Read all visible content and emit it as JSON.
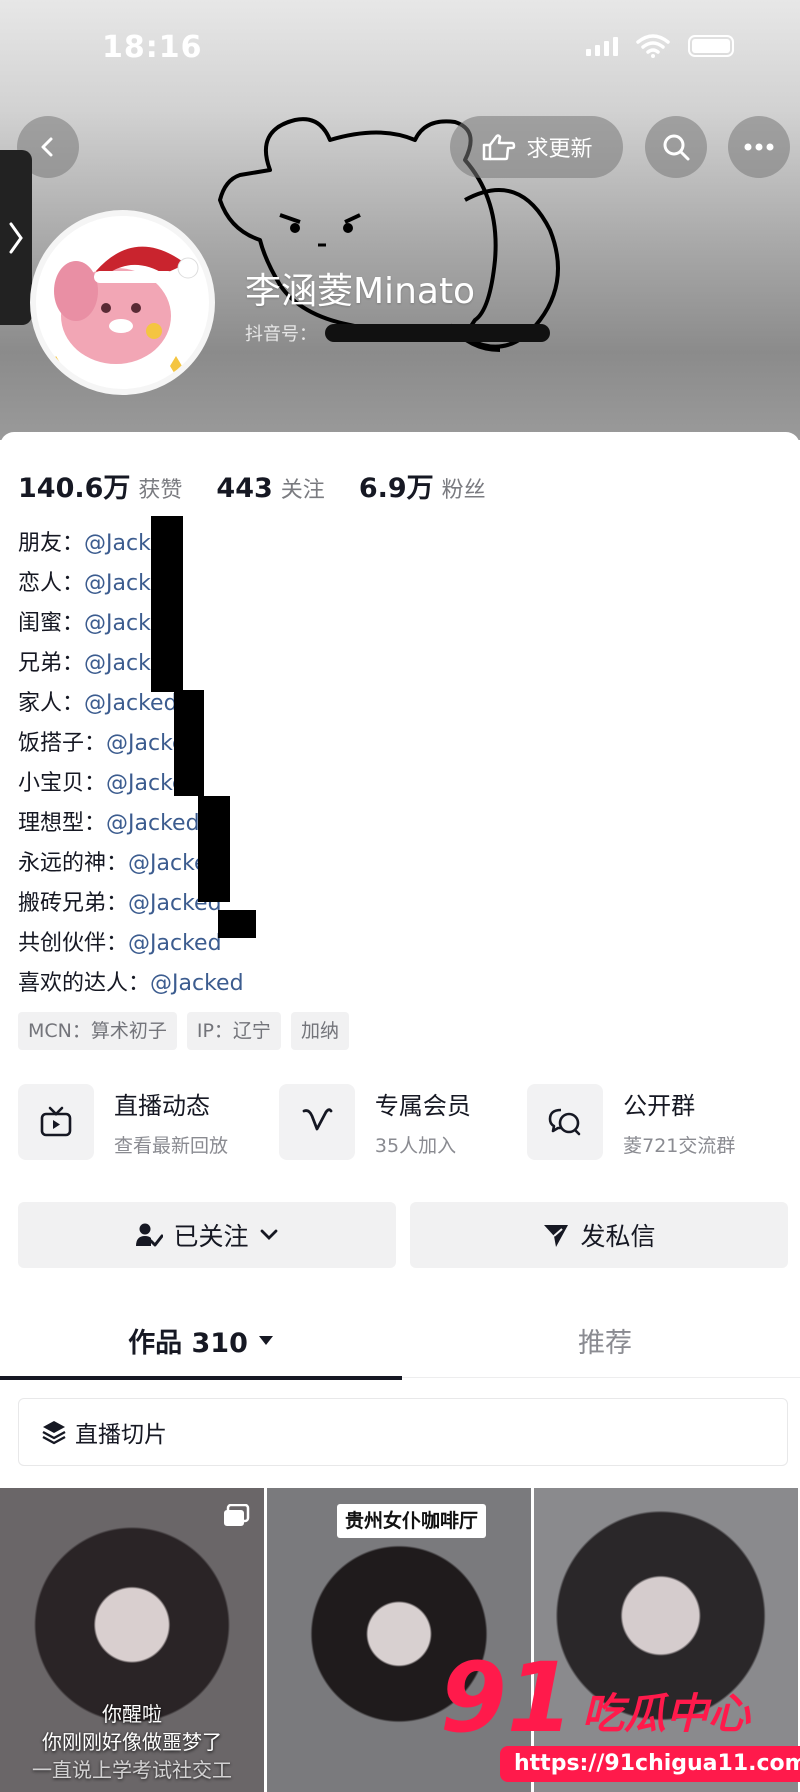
{
  "status_bar": {
    "time": "18:16"
  },
  "header": {
    "update_label": "求更新",
    "nickname": "李涵菱Minato",
    "douyin_id_label": "抖音号："
  },
  "stats": [
    {
      "value": "140.6万",
      "label": "获赞"
    },
    {
      "value": "443",
      "label": "关注"
    },
    {
      "value": "6.9万",
      "label": "粉丝"
    }
  ],
  "bio": [
    {
      "label": "朋友：",
      "mention": "@Jacked"
    },
    {
      "label": "恋人：",
      "mention": "@Jacked"
    },
    {
      "label": "闺蜜：",
      "mention": "@Jacked"
    },
    {
      "label": "兄弟：",
      "mention": "@Jacked"
    },
    {
      "label": "家人：",
      "mention": "@Jacked"
    },
    {
      "label": "饭搭子：",
      "mention": "@Jacked"
    },
    {
      "label": "小宝贝：",
      "mention": "@Jacked"
    },
    {
      "label": "理想型：",
      "mention": "@Jacked"
    },
    {
      "label": "永远的神：",
      "mention": "@Jacked"
    },
    {
      "label": "搬砖兄弟：",
      "mention": "@Jacked"
    },
    {
      "label": "共创伙伴：",
      "mention": "@Jacked"
    },
    {
      "label": "喜欢的达人：",
      "mention": "@Jacked"
    }
  ],
  "tags": [
    "MCN：算术初子",
    "IP：辽宁",
    "加纳"
  ],
  "features": [
    {
      "icon": "tv-icon",
      "title": "直播动态",
      "subtitle": "查看最新回放"
    },
    {
      "icon": "v-badge-icon",
      "title": "专属会员",
      "subtitle": "35人加入"
    },
    {
      "icon": "chat-bubbles-icon",
      "title": "公开群",
      "subtitle": "菱721交流群"
    }
  ],
  "actions": {
    "follow_label": "已关注",
    "message_label": "发私信"
  },
  "tabs": {
    "works_label": "作品 310",
    "recommend_label": "推荐"
  },
  "slice_label": "直播切片",
  "thumbnails": [
    {
      "captions": [
        "你醒啦",
        "你刚刚好像做噩梦了",
        "一直说上学考试社交工"
      ]
    },
    {
      "sign": "贵州女仆咖啡厅"
    },
    {}
  ],
  "watermark": {
    "number": "91",
    "name": "吃瓜中心",
    "url": "https://91chigua11.com"
  },
  "colors": {
    "mention": "#3c5c8f",
    "watermark": "#ff1a4b",
    "text": "#161823",
    "muted": "#7a7b80"
  }
}
